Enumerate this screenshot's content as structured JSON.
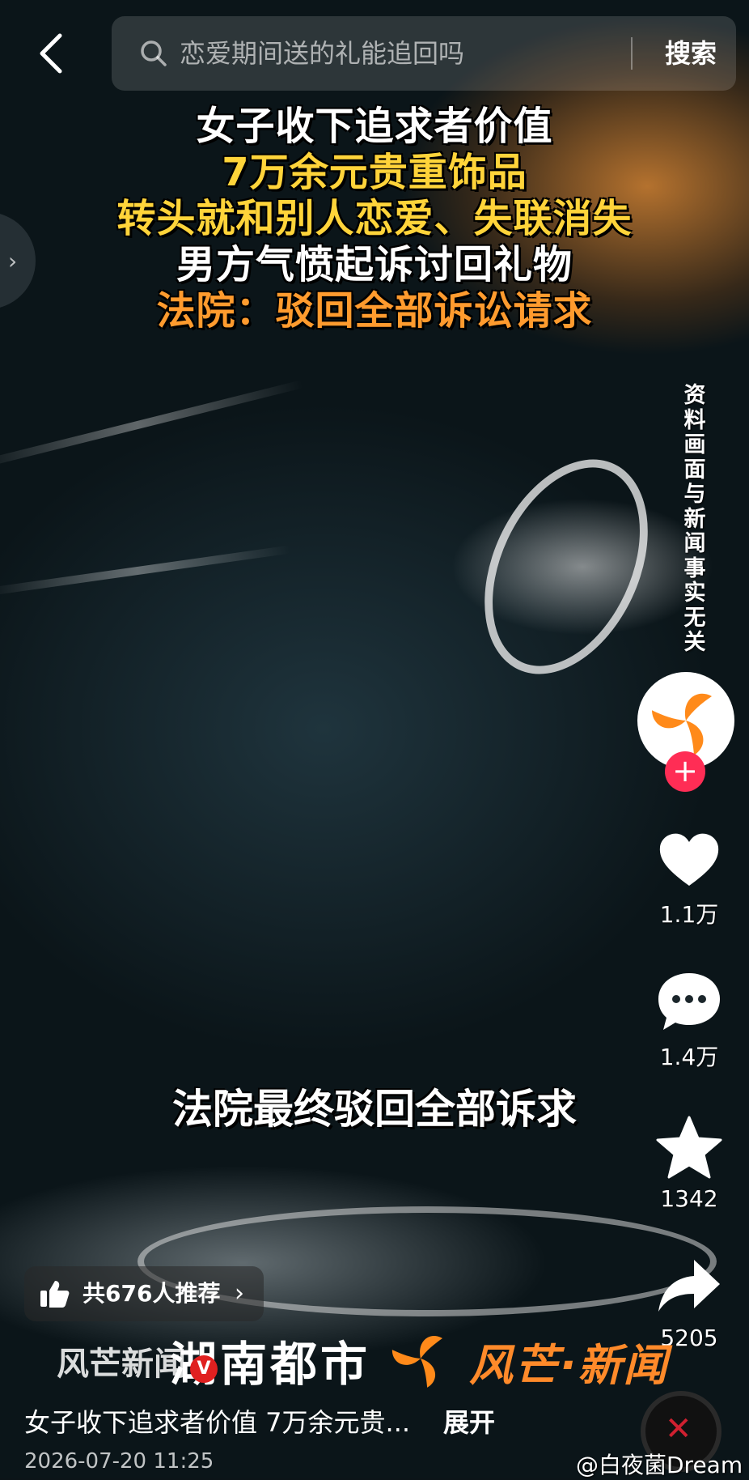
{
  "search": {
    "query": "恋爱期间送的礼能追回吗",
    "button": "搜索"
  },
  "headline": {
    "line1": "女子收下追求者价值",
    "line2": "7万余元贵重饰品",
    "line3": "转头就和别人恋爱、失联消失",
    "line4": "男方气愤起诉讨回礼物",
    "line5": "法院：驳回全部诉讼请求"
  },
  "sidebar_handle": "›",
  "disclaimer": "资料画面与新闻事实无关",
  "actions": {
    "likes": "1.1万",
    "comments": "1.4万",
    "favorites": "1342",
    "shares": "5205"
  },
  "subtitle": "法院最终驳回全部诉求",
  "recommend": {
    "label": "共676人推荐",
    "chevron": "›"
  },
  "logos": {
    "left_partial": "风芒新闻",
    "channel": "湖南都市",
    "brand": "风芒·新闻",
    "badge": "V"
  },
  "caption": {
    "text": "女子收下追求者价值 7万余元贵...",
    "expand": "展开"
  },
  "timestamp": "2026-07-20 11:25",
  "watermark": "@白夜菌Dream",
  "colors": {
    "accent_pink": "#ff2d55",
    "headline_yellow": "#ffd43a",
    "headline_orange": "#ff9b2e",
    "brand_orange": "#ff8a2a"
  }
}
